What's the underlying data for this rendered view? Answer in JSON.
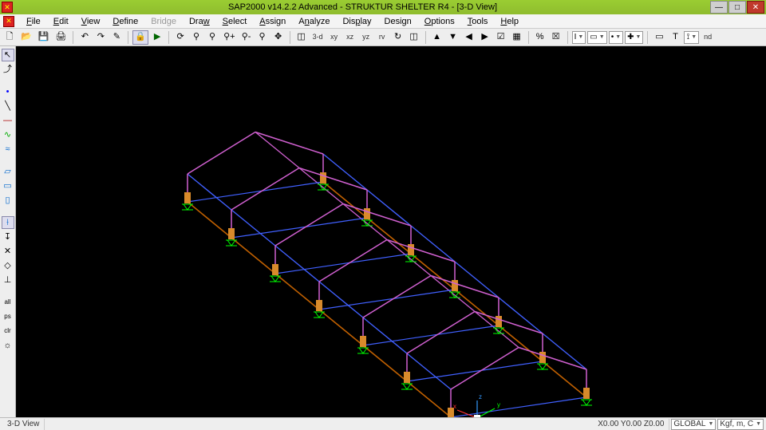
{
  "title": "SAP2000 v14.2.2 Advanced  - STRUKTUR SHELTER R4 - [3-D View]",
  "wincontrols": {
    "min": "—",
    "max": "□",
    "close": "✕"
  },
  "menu": {
    "file": "File",
    "edit": "Edit",
    "view": "View",
    "define": "Define",
    "bridge": "Bridge",
    "draw": "Draw",
    "select": "Select",
    "assign": "Assign",
    "analyze": "Analyze",
    "display": "Display",
    "design": "Design",
    "options": "Options",
    "tools": "Tools",
    "help": "Help"
  },
  "toolbar": {
    "views": {
      "v3d": "3-d",
      "xy": "xy",
      "xz": "xz",
      "yz": "yz",
      "rv": "rv"
    },
    "nudge": "nd",
    "icons": {
      "new": "🗋",
      "open": "📂",
      "save": "💾",
      "print": "🖨",
      "undo": "↶",
      "redo": "↷",
      "pencil": "✎",
      "lock": "🔒",
      "run": "▶",
      "refresh": "⟳",
      "zoomin": "⚲+",
      "zoomout": "⚲-",
      "zoomfit": "⚲",
      "zoomprev": "⚲",
      "zoomall": "⚲",
      "pan": "✥",
      "rotate": "↻",
      "persp": "◫",
      "up": "▲",
      "down": "▼",
      "left": "◀",
      "right": "▶",
      "check": "☑",
      "grid": "▦",
      "showsel": "%",
      "showall": "☒",
      "assigni": "I",
      "assignj": "▭",
      "assignh": "•",
      "assignr": "✚",
      "frame": "▭",
      "frameT": "T",
      "ruler": "⟟"
    }
  },
  "sidebar_icons": {
    "pointer": "↖",
    "pushpin": "⤴",
    "line1": "╲",
    "line2": "—",
    "cable": "∿",
    "tendon": "≈",
    "area": "▱",
    "rect": "▭",
    "rect2": "▯",
    "snap1": "⟊",
    "snap2": "↧",
    "snap3": "✕",
    "snap4": "◇",
    "snap5": "⊥",
    "txt_all": "all",
    "txt_ps": "ps",
    "txt_clr": "clr",
    "txt_int": "☼"
  },
  "status": {
    "view": "3-D View",
    "coords": "X0.00  Y0.00  Z0.00",
    "dd1": "GLOBAL",
    "dd2": "Kgf, m, C"
  }
}
